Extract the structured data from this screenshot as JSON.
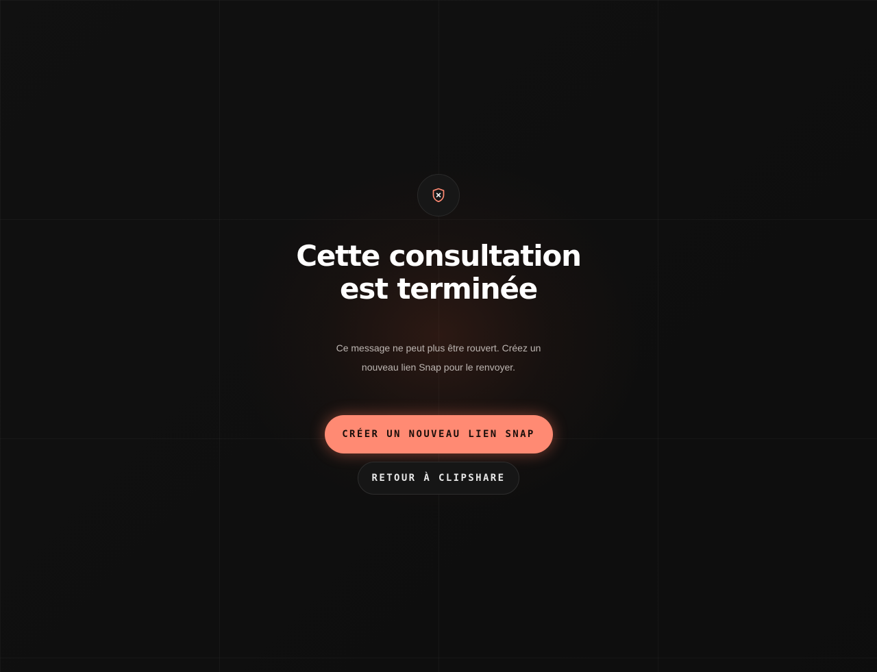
{
  "page": {
    "title_line": "Cette consultation est terminée",
    "subtitle": "Ce message ne peut plus être rouvert. Créez un nouveau lien Snap pour le renvoyer."
  },
  "actions": {
    "primary_label": "CRÉER UN NOUVEAU LIEN SNAP",
    "secondary_label": "RETOUR À CLIPSHARE"
  },
  "icons": {
    "status": "shield-x-icon"
  },
  "colors": {
    "accent": "#ff8a73",
    "background": "#0d0d0d",
    "text_primary": "#ffffff",
    "text_secondary": "#bdb6b2"
  }
}
